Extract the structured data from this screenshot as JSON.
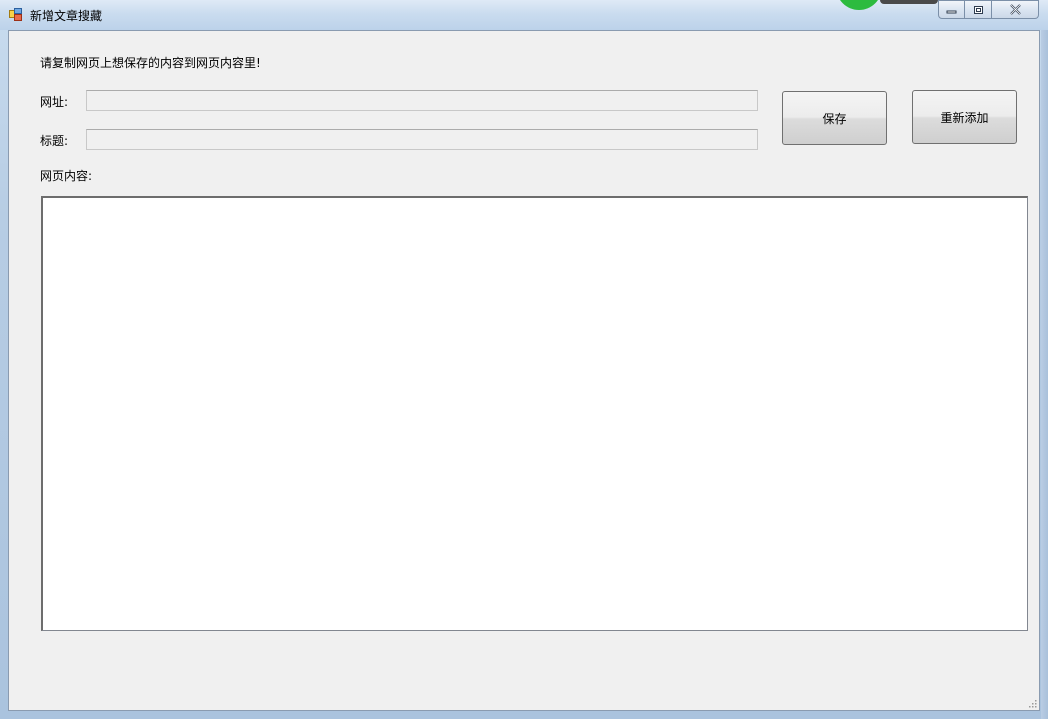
{
  "window": {
    "title": "新增文章搜藏",
    "icon": "app-window-icon",
    "controls": {
      "minimize_icon": "minimize-icon",
      "maximize_icon": "restore-icon",
      "close_icon": "close-icon"
    }
  },
  "form": {
    "instruction": "请复制网页上想保存的内容到网页内容里!",
    "url_label": "网址:",
    "url_value": "",
    "title_label": "标题:",
    "title_value": "",
    "content_label": "网页内容:",
    "content_value": ""
  },
  "buttons": {
    "save_label": "保存",
    "reset_label": "重新添加"
  },
  "colors": {
    "client_background": "#f0f0f0",
    "titlebar": "#cadcef",
    "content_background": "#ffffff"
  }
}
